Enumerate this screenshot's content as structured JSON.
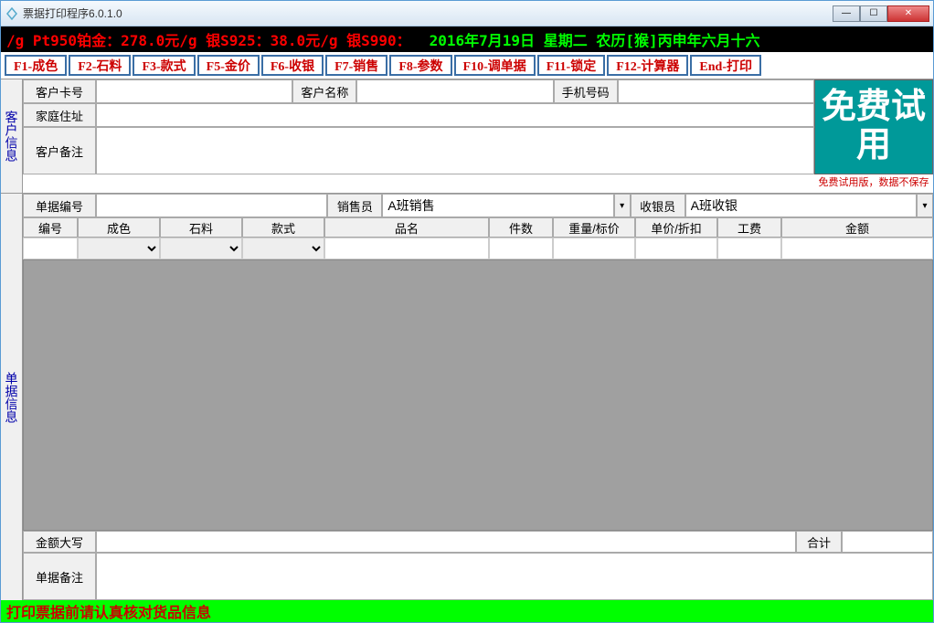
{
  "window": {
    "title": "票据打印程序6.0.1.0"
  },
  "marquee": {
    "part1": "/g  Pt950铂金：278.0元/g  银S925：38.0元/g  银S990：",
    "part2": "2016年7月19日 星期二 农历[猴]丙申年六月十六"
  },
  "fn_buttons": [
    "F1-成色",
    "F2-石料",
    "F3-款式",
    "F5-金价",
    "F6-收银",
    "F7-销售",
    "F8-参数",
    "F10-调单据",
    "F11-锁定",
    "F12-计算器",
    "End-打印"
  ],
  "side": {
    "customer": "客户信息",
    "bill": "单据信息"
  },
  "customer": {
    "labels": {
      "card_no": "客户卡号",
      "name": "客户名称",
      "phone": "手机号码",
      "addr": "家庭住址",
      "remark": "客户备注"
    },
    "values": {
      "card_no": "",
      "name": "",
      "phone": "",
      "addr": "",
      "remark": ""
    }
  },
  "promo": {
    "big": "免费试用",
    "note": "免费试用版，数据不保存"
  },
  "bill": {
    "labels": {
      "bill_no": "单据编号",
      "seller": "销售员",
      "cashier": "收银员"
    },
    "values": {
      "bill_no": "",
      "seller": "A班销售",
      "cashier": "A班收银"
    }
  },
  "table": {
    "headers": [
      "编号",
      "成色",
      "石料",
      "款式",
      "品名",
      "件数",
      "重量/标价",
      "单价/折扣",
      "工费",
      "金额"
    ]
  },
  "totals": {
    "labels": {
      "amount_cn": "金额大写",
      "total": "合计"
    },
    "values": {
      "amount_cn": "",
      "total": ""
    }
  },
  "remark": {
    "label": "单据备注",
    "value": ""
  },
  "footer": "打印票据前请认真核对货品信息"
}
